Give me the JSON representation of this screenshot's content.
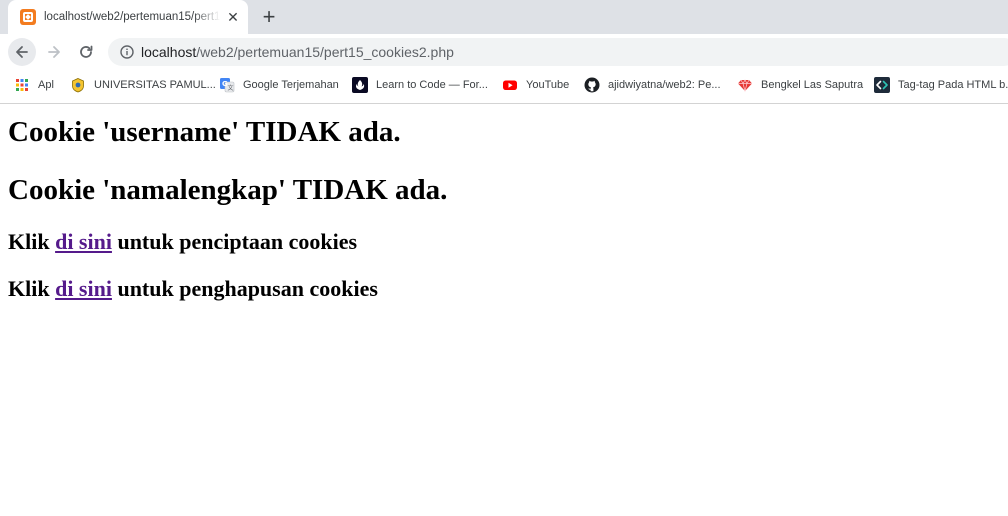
{
  "tab": {
    "title": "localhost/web2/pertemuan15/pert15_cookies2.php",
    "favicon": "xampp-icon",
    "close_label": "✕",
    "new_tab_label": "+"
  },
  "toolbar": {
    "url_host": "localhost",
    "url_path": "/web2/pertemuan15/pert15_cookies2.php"
  },
  "bookmarks": [
    {
      "label": "Apl",
      "icon": "apps-grid-icon"
    },
    {
      "label": "UNIVERSITAS PAMUL...",
      "icon": "university-logo-icon"
    },
    {
      "label": "Google Terjemahan",
      "icon": "google-translate-icon"
    },
    {
      "label": "Learn to Code — For...",
      "icon": "freecodecamp-icon"
    },
    {
      "label": "YouTube",
      "icon": "youtube-icon"
    },
    {
      "label": "ajidwiyatna/web2: Pe...",
      "icon": "github-icon"
    },
    {
      "label": "Bengkel Las Saputra",
      "icon": "gem-icon"
    },
    {
      "label": "Tag-tag Pada HTML b...",
      "icon": "codepolitan-icon"
    }
  ],
  "page": {
    "heading_username": "Cookie 'username' TIDAK ada.",
    "heading_namalengkap": "Cookie 'namalengkap' TIDAK ada.",
    "create_prefix": "Klik ",
    "create_link": "di sini",
    "create_suffix": " untuk penciptaan cookies",
    "delete_prefix": "Klik ",
    "delete_link": "di sini",
    "delete_suffix": " untuk penghapusan cookies"
  },
  "colors": {
    "visited_link": "#551a8b",
    "tabstrip_bg": "#dee1e6",
    "omnibox_bg": "#f1f3f4"
  }
}
